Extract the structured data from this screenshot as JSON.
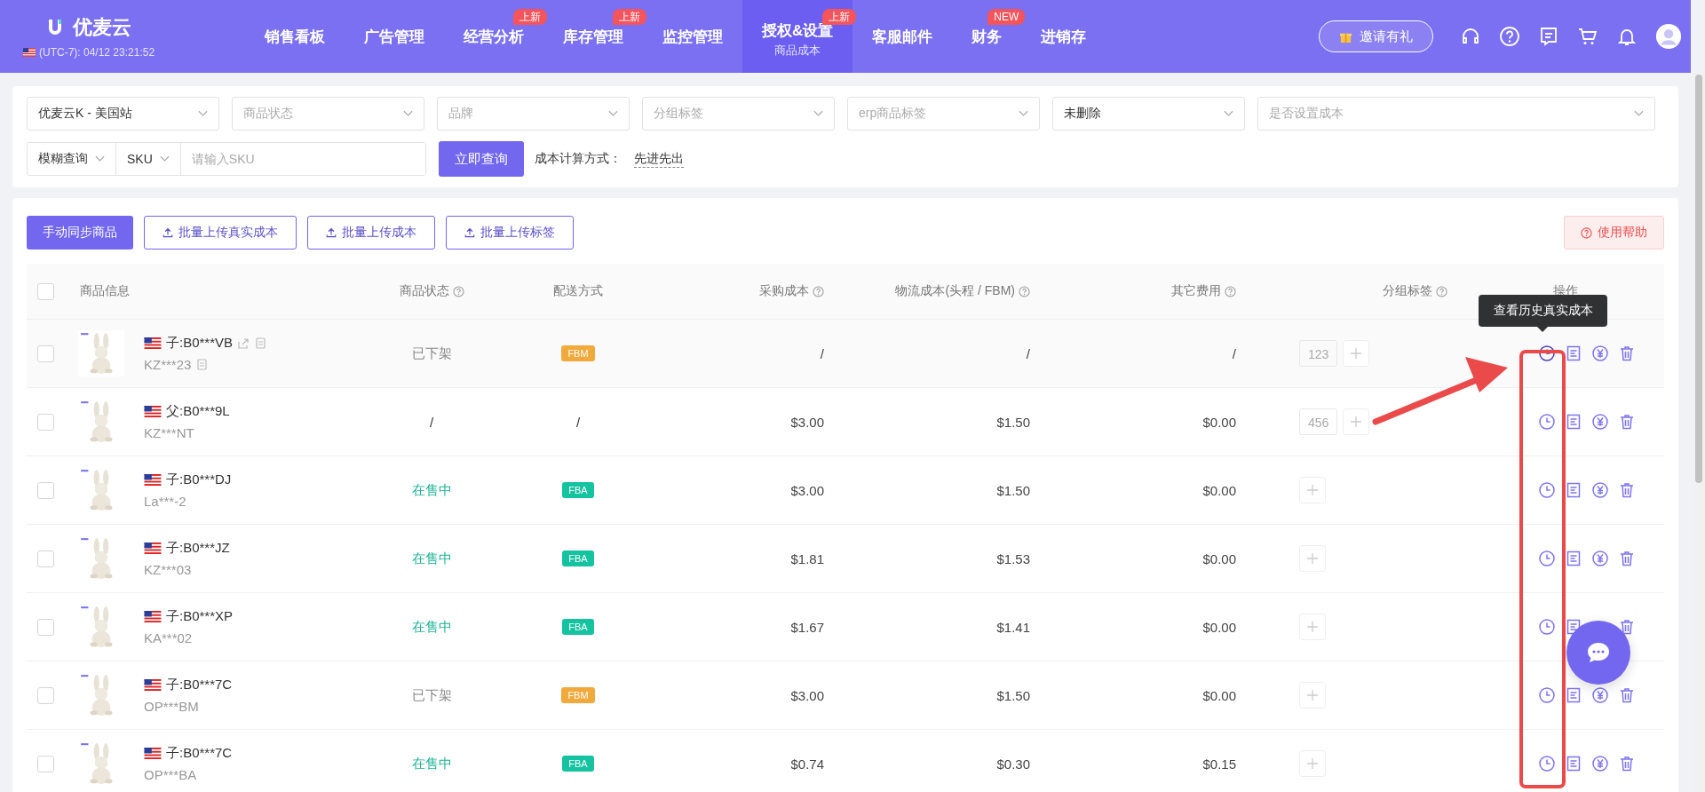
{
  "brand": {
    "name": "优麦云",
    "time": "(UTC-7): 04/12 23:21:52"
  },
  "nav": [
    {
      "label": "销售看板",
      "selected": false
    },
    {
      "label": "广告管理",
      "selected": false
    },
    {
      "label": "经营分析",
      "selected": false,
      "badge": "上新"
    },
    {
      "label": "库存管理",
      "selected": false,
      "badge": "上新"
    },
    {
      "label": "监控管理",
      "selected": false
    },
    {
      "label": "授权&设置",
      "selected": true,
      "badge": "上新",
      "sub": "商品成本"
    },
    {
      "label": "客服邮件",
      "selected": false
    },
    {
      "label": "财务",
      "selected": false,
      "badge": "NEW"
    },
    {
      "label": "进销存",
      "selected": false
    }
  ],
  "invite_button": "邀请有礼",
  "filters": [
    {
      "value": "优麦云K - 美国站"
    },
    {
      "placeholder": "商品状态"
    },
    {
      "placeholder": "品牌"
    },
    {
      "placeholder": "分组标签"
    },
    {
      "placeholder": "erp商品标签"
    },
    {
      "value": "未删除"
    },
    {
      "placeholder": "是否设置成本"
    }
  ],
  "search": {
    "mode": "模糊查询",
    "field": "SKU",
    "placeholder": "请输入SKU",
    "button": "立即查询",
    "method_label": "成本计算方式：",
    "method": "先进先出"
  },
  "toolbar": {
    "sync_button": "手动同步商品",
    "upload_buttons": [
      "批量上传真实成本",
      "批量上传成本",
      "批量上传标签"
    ],
    "help_button": "使用帮助"
  },
  "table": {
    "select_all": {
      "checked": false
    },
    "columns": [
      "商品信息",
      "商品状态",
      "配送方式",
      "采购成本",
      "物流成本(头程 / FBM)",
      "其它费用",
      "分组标签",
      "操作"
    ],
    "rows": [
      {
        "checked": false,
        "asin": "子:B0***VB",
        "sku": "KZ***23",
        "copy_icons": true,
        "status": {
          "text": "已下架",
          "kind": "off"
        },
        "shipping": {
          "text": "FBM",
          "kind": "fbm"
        },
        "purchase": "/",
        "logistics": "/",
        "other": "/",
        "tags": [
          "123"
        ],
        "highlighted": true
      },
      {
        "checked": false,
        "asin": "父:B0***9L",
        "sku": "KZ***NT",
        "copy_icons": false,
        "status": {
          "text": "/",
          "kind": "plain"
        },
        "shipping": {
          "text": "/",
          "kind": "plain"
        },
        "purchase": "$3.00",
        "logistics": "$1.50",
        "other": "$0.00",
        "tags": [
          "456"
        ],
        "highlighted": false
      },
      {
        "checked": false,
        "asin": "子:B0***DJ",
        "sku": "La***-2",
        "copy_icons": false,
        "status": {
          "text": "在售中",
          "kind": "on"
        },
        "shipping": {
          "text": "FBA",
          "kind": "fba"
        },
        "purchase": "$3.00",
        "logistics": "$1.50",
        "other": "$0.00",
        "highlighted": false
      },
      {
        "checked": false,
        "asin": "子:B0***JZ",
        "sku": "KZ***03",
        "copy_icons": false,
        "status": {
          "text": "在售中",
          "kind": "on"
        },
        "shipping": {
          "text": "FBA",
          "kind": "fba"
        },
        "purchase": "$1.81",
        "logistics": "$1.53",
        "other": "$0.00",
        "highlighted": false
      },
      {
        "checked": false,
        "asin": "子:B0***XP",
        "sku": "KA***02",
        "copy_icons": false,
        "status": {
          "text": "在售中",
          "kind": "on"
        },
        "shipping": {
          "text": "FBA",
          "kind": "fba"
        },
        "purchase": "$1.67",
        "logistics": "$1.41",
        "other": "$0.00",
        "highlighted": false
      },
      {
        "checked": false,
        "asin": "子:B0***7C",
        "sku": "OP***BM",
        "copy_icons": false,
        "status": {
          "text": "已下架",
          "kind": "off"
        },
        "shipping": {
          "text": "FBM",
          "kind": "fbm"
        },
        "purchase": "$3.00",
        "logistics": "$1.50",
        "other": "$0.00",
        "highlighted": false
      },
      {
        "checked": false,
        "asin": "子:B0***7C",
        "sku": "OP***BA",
        "copy_icons": false,
        "status": {
          "text": "在售中",
          "kind": "on"
        },
        "shipping": {
          "text": "FBA",
          "kind": "fba"
        },
        "purchase": "$0.74",
        "logistics": "$0.30",
        "other": "$0.15",
        "highlighted": false
      }
    ]
  },
  "tooltip": "查看历史真实成本"
}
